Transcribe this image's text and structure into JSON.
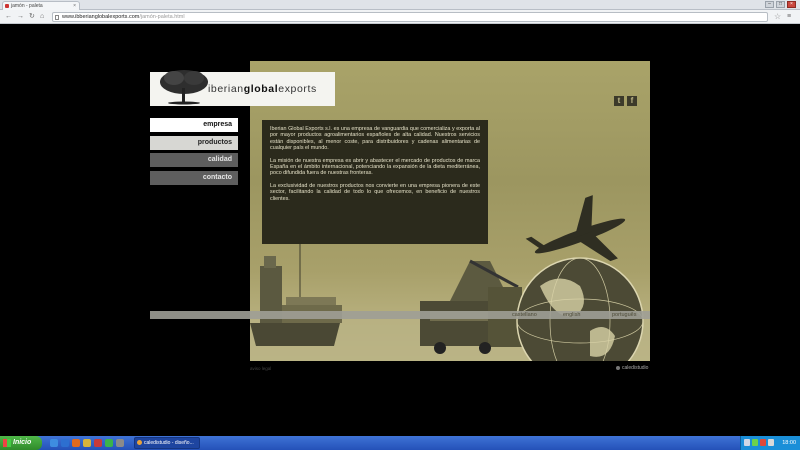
{
  "browser": {
    "tab_title": "jamón - paleta",
    "url_domain": "www.ibberianglobalexports.com",
    "url_path": "/jamón-paleta.html"
  },
  "logo": {
    "brand_light": "iberian",
    "brand_bold": "global",
    "brand_suffix": "exports"
  },
  "social": {
    "twitter": "t",
    "facebook": "f"
  },
  "menu": {
    "items": [
      {
        "label": "empresa"
      },
      {
        "label": "productos"
      },
      {
        "label": "calidad"
      },
      {
        "label": "contacto"
      }
    ]
  },
  "content": {
    "p1": "Iberian Global Exports s.l. es una empresa de vanguardia que comercializa y exporta al por mayor productos agroalimentarios españoles de alta calidad. Nuestros servicios están disponibles, al menor coste, para distribuidores y cadenas alimentarias de cualquier país el mundo.",
    "p2": "La misión de nuestra empresa es abrir y abastecer el mercado de productos de marca España en el ámbito internacional, potenciando la expansión de la dieta mediterránea, poco difundida fuera de nuestras fronteras.",
    "p3": "La exclusividad de nuestros productos nos convierte en una empresa pionera de este sector, facilitando la calidad de todo lo que ofrecemos, en beneficio de nuestros clientes."
  },
  "languages": {
    "castellano": "castellano",
    "english": "english",
    "portugues": "português"
  },
  "footer": {
    "legal": "aviso legal",
    "credit": "caledistudio"
  },
  "taskbar": {
    "start_label": "Inicio",
    "task_label": "caledistudio - diseño...",
    "clock": "18:00"
  }
}
